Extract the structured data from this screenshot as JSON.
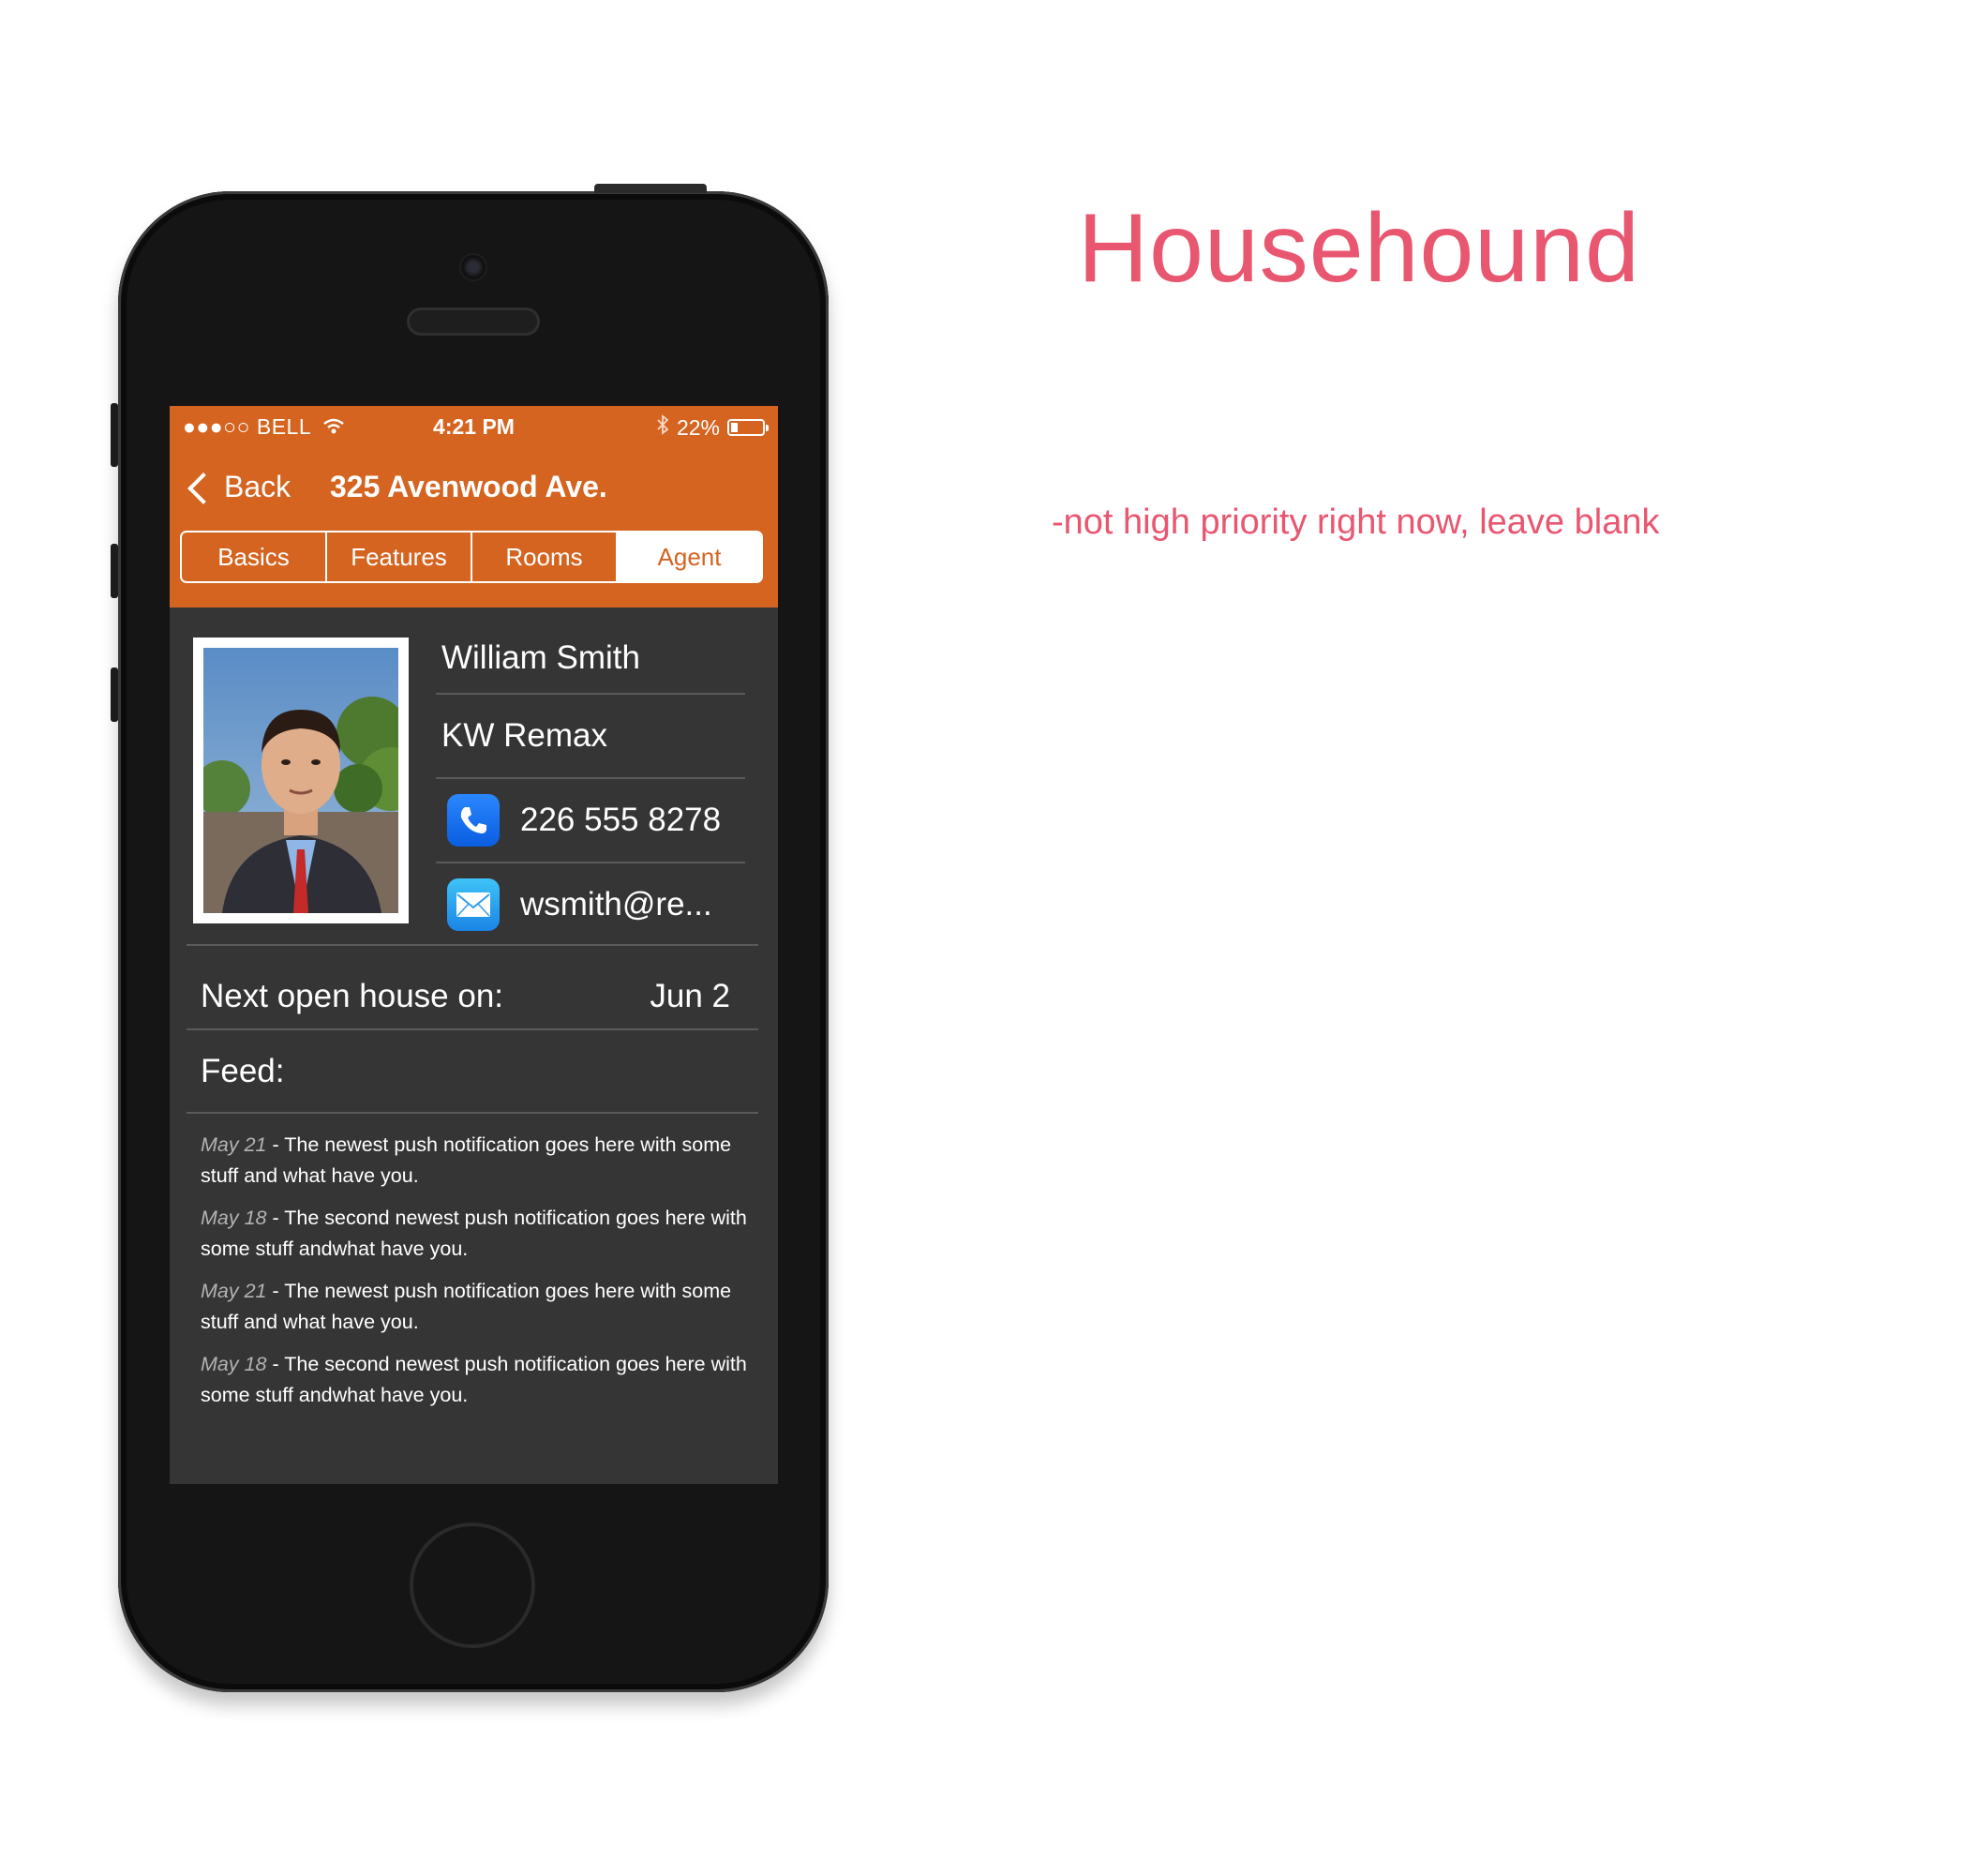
{
  "app_title": "Househound",
  "note": "-not high priority right now, leave blank",
  "status_bar": {
    "carrier": "●●●○○ BELL",
    "time": "4:21 PM",
    "battery_label": "22%",
    "battery_level": 0.22,
    "icons": [
      "wifi-icon",
      "bluetooth-icon",
      "battery-icon"
    ]
  },
  "nav": {
    "back_label": "Back",
    "title": "325 Avenwood Ave."
  },
  "tabs": [
    {
      "label": "Basics",
      "active": false
    },
    {
      "label": "Features",
      "active": false
    },
    {
      "label": "Rooms",
      "active": false
    },
    {
      "label": "Agent",
      "active": true
    }
  ],
  "agent": {
    "name": "William Smith",
    "company": "KW Remax",
    "phone": "226 555 8278",
    "email": "wsmith@re..."
  },
  "open_house": {
    "label": "Next open house on:",
    "date": "Jun 2"
  },
  "feed": {
    "label": "Feed:",
    "items": [
      {
        "date": "May 21",
        "text": " - The newest push notification goes here with some stuff and what have you."
      },
      {
        "date": "May 18",
        "text": " - The second newest push notification goes here with some stuff andwhat have you."
      },
      {
        "date": "May 21",
        "text": " - The newest push notification goes here with some stuff and what have you."
      },
      {
        "date": "May 18",
        "text": " - The second newest push notification goes here with some stuff andwhat have you."
      }
    ]
  },
  "colors": {
    "accent": "#d46420",
    "screen_bg": "#353535",
    "annotation": "#e85670",
    "phone_icon": "#0a5de0",
    "mail_icon": "#1a84e6"
  }
}
